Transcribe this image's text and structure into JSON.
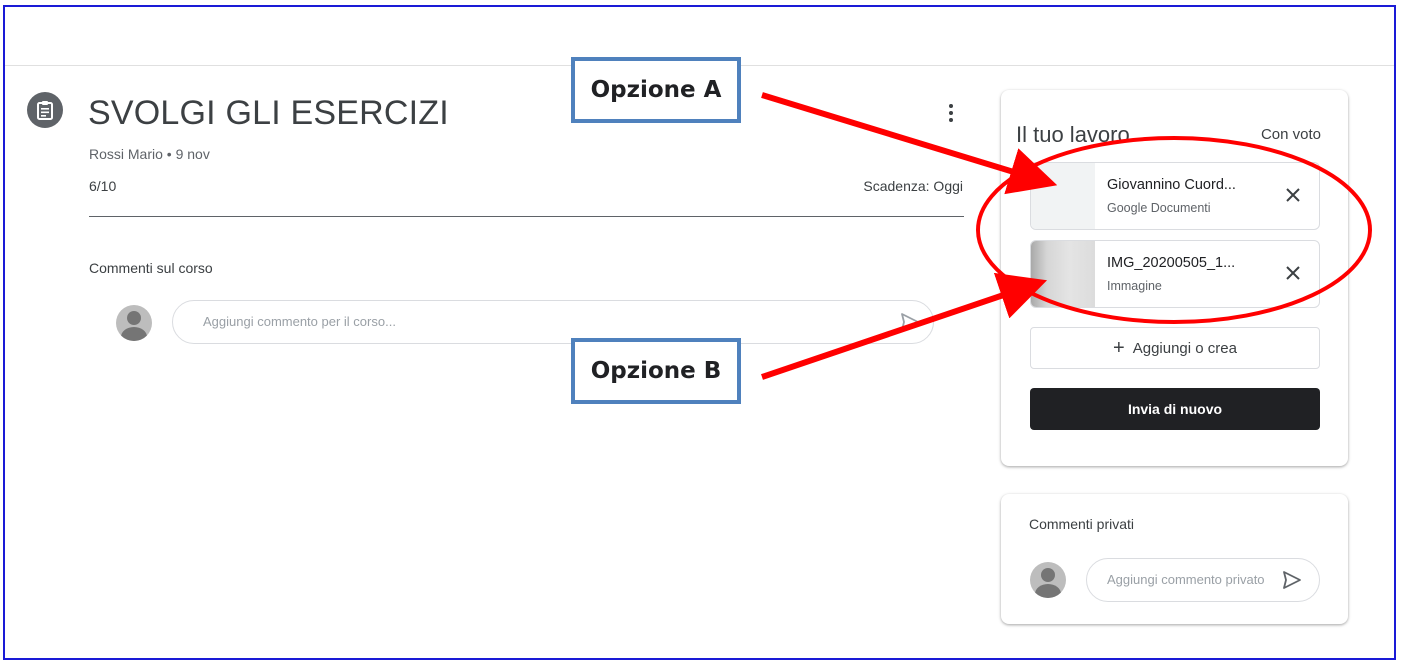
{
  "assignment": {
    "title": "SVOLGI GLI ESERCIZI",
    "meta": "Rossi Mario • 9 nov",
    "grade": "6/10",
    "due": "Scadenza: Oggi"
  },
  "class_comments": {
    "label": "Commenti sul corso",
    "placeholder": "Aggiungi commento per il corso..."
  },
  "your_work": {
    "title": "Il tuo lavoro",
    "status": "Con voto",
    "attachments": [
      {
        "name": "Giovannino Cuord...",
        "type": "Google Documenti"
      },
      {
        "name": "IMG_20200505_1...",
        "type": "Immagine"
      }
    ],
    "add_label": "Aggiungi o crea",
    "submit_label": "Invia di nuovo"
  },
  "private_comments": {
    "label": "Commenti privati",
    "placeholder": "Aggiungi commento privato"
  },
  "annotations": {
    "option_a": "Opzione A",
    "option_b": "Opzione B"
  },
  "colors": {
    "arrow": "#ff0000",
    "callout_border": "#4f81bd",
    "frame_border": "#1a1ad6",
    "submit_bg": "#202124"
  },
  "icons": [
    "assignment-icon",
    "more-vert-icon",
    "send-icon",
    "close-icon",
    "plus-icon",
    "avatar-icon"
  ]
}
